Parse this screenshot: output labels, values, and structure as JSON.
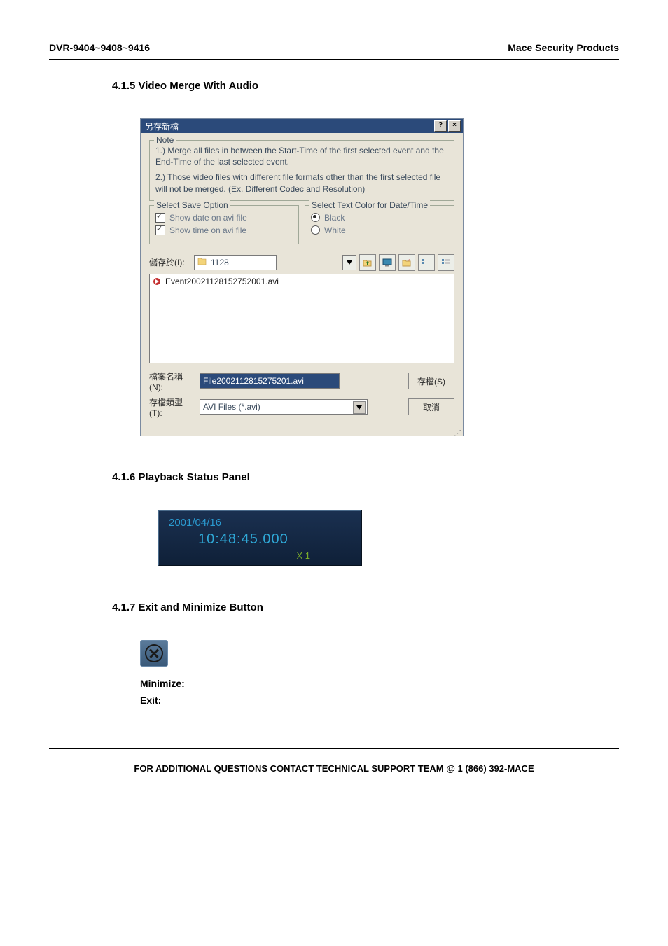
{
  "header": {
    "left": "DVR-9404~9408~9416",
    "right": "Mace Security Products"
  },
  "sections": {
    "s1": {
      "title": "4.1.5 Video Merge With Audio"
    },
    "s2": {
      "title": "4.1.6 Playback Status Panel"
    },
    "s3": {
      "title": "4.1.7 Exit and Minimize Button"
    }
  },
  "dialog": {
    "title": "另存新檔",
    "help_btn": "?",
    "close_btn": "×",
    "note": {
      "label": "Note",
      "line1": "1.) Merge all files in between the Start-Time of the first selected event and the End-Time of the last selected event.",
      "line2": "2.) Those video files with different file formats other than the first selected file will not be merged. (Ex. Different Codec and Resolution)"
    },
    "save_option": {
      "label": "Select Save Option",
      "chk1": "Show date on avi file",
      "chk2": "Show time on avi file"
    },
    "text_color": {
      "label": "Select Text Color for Date/Time",
      "opt1": "Black",
      "opt2": "White"
    },
    "save_in": {
      "label": "儲存於(I):",
      "folder": "1128"
    },
    "file_list": {
      "item1": "Event20021128152752001.avi"
    },
    "filename": {
      "label": "檔案名稱(N):",
      "value": "File2002112815275201.avi"
    },
    "filetype": {
      "label": "存檔類型(T):",
      "value": "AVI Files (*.avi)"
    },
    "buttons": {
      "save": "存檔(S)",
      "cancel": "取消"
    }
  },
  "status": {
    "date": "2001/04/16",
    "time": "10:48:45.000",
    "speed": "X 1"
  },
  "terms": {
    "minimize": "Minimize:",
    "exit": "Exit:"
  },
  "footer": "FOR ADDITIONAL QUESTIONS CONTACT TECHNICAL SUPPORT TEAM @ 1 (866) 392-MACE"
}
